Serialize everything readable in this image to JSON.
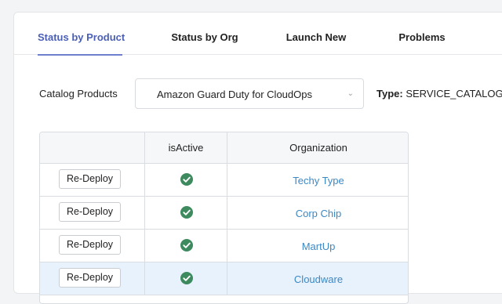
{
  "tabs": [
    {
      "label": "Status by Product",
      "active": true
    },
    {
      "label": "Status by Org"
    },
    {
      "label": "Launch New"
    },
    {
      "label": "Problems"
    }
  ],
  "catalog": {
    "label": "Catalog Products",
    "selected": "Amazon Guard Duty for CloudOps",
    "type_label": "Type:",
    "type_value": "SERVICE_CATALOG"
  },
  "table": {
    "headers": [
      "",
      "isActive",
      "Organization"
    ],
    "rows": [
      {
        "action": "Re-Deploy",
        "active": "check-circle-icon",
        "org": "Techy Type"
      },
      {
        "action": "Re-Deploy",
        "active": "check-circle-icon",
        "org": "Corp Chip"
      },
      {
        "action": "Re-Deploy",
        "active": "check-circle-icon",
        "org": "MartUp"
      },
      {
        "action": "Re-Deploy",
        "active": "check-circle-icon",
        "org": "Cloudware"
      }
    ]
  },
  "colors": {
    "active_tab": "#4a5fb5",
    "link": "#3b88c4",
    "check": "#3d8a5e",
    "highlight_row": "#e8f2fc"
  }
}
